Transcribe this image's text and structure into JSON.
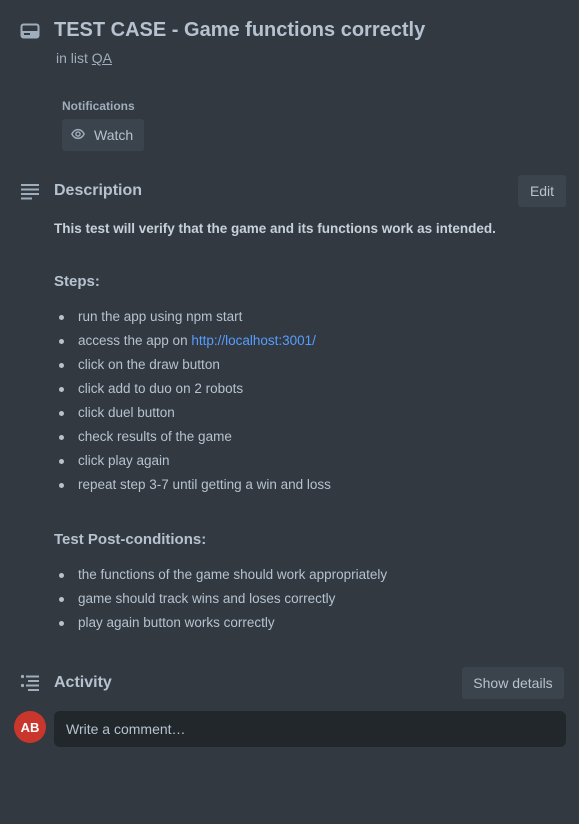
{
  "card": {
    "title": "TEST CASE - Game functions correctly",
    "in_list_prefix": "in list",
    "list_name": "QA"
  },
  "notifications": {
    "label": "Notifications",
    "watch_label": "Watch"
  },
  "description": {
    "title": "Description",
    "edit_label": "Edit",
    "intro": "This test will verify that the game and its functions work as intended.",
    "steps_heading": "Steps:",
    "steps": [
      "run the app using npm start",
      "access the app on",
      "click on the draw button",
      "click add to duo on 2 robots",
      "click duel button",
      "check results of the game",
      "click play again",
      "repeat step 3-7 until getting a win and loss"
    ],
    "step_link": "http://localhost:3001/",
    "post_heading": "Test Post-conditions:",
    "post_conditions": [
      "the functions of the game should work appropriately",
      "game should track wins and loses correctly",
      "play again button works correctly"
    ]
  },
  "activity": {
    "title": "Activity",
    "show_details_label": "Show details",
    "avatar_initials": "AB",
    "comment_placeholder": "Write a comment…"
  },
  "colors": {
    "background": "#323940",
    "link": "#579dff",
    "avatar": "#c9372c"
  }
}
